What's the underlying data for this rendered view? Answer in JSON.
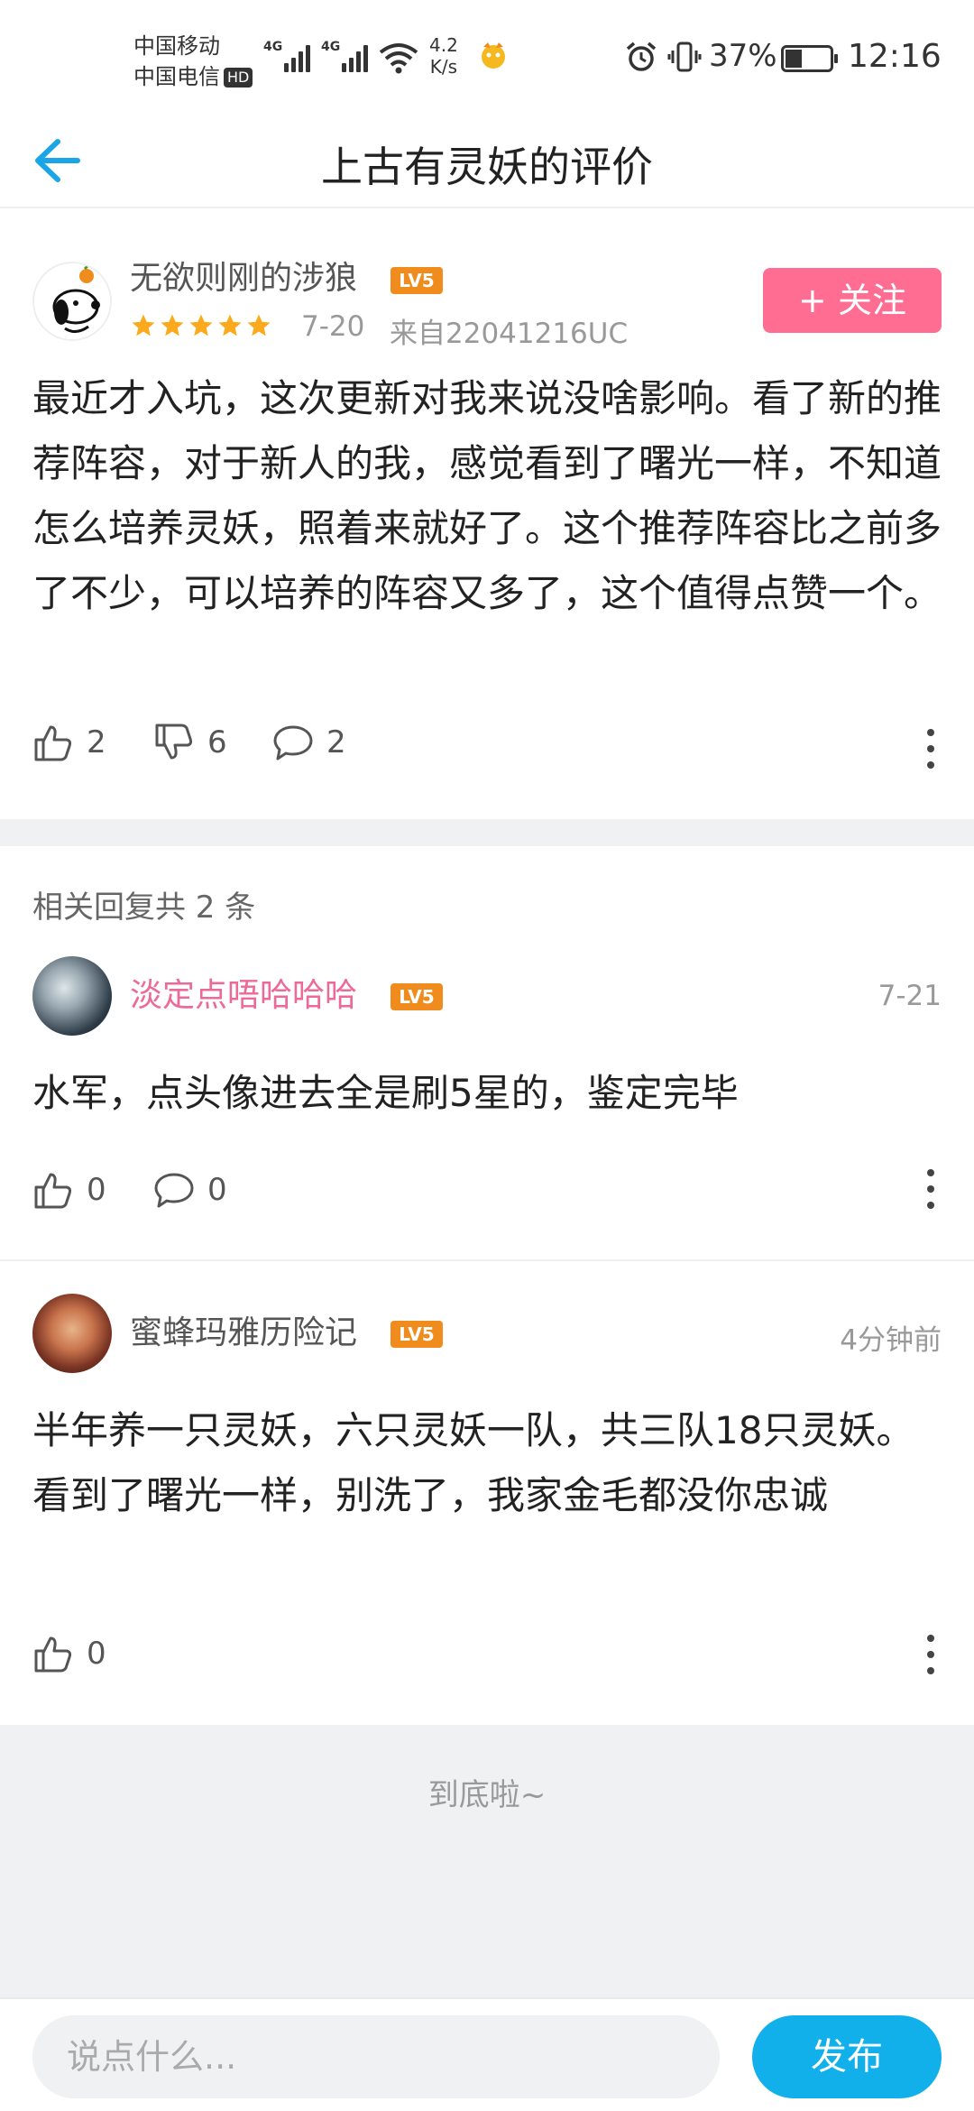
{
  "status_bar": {
    "carrier1": "中国移动",
    "carrier2": "中国电信",
    "hd": "HD",
    "net1": "4G",
    "net2": "4G",
    "speed_value": "4.2",
    "speed_unit": "K/s",
    "battery": "37%",
    "time": "12:16"
  },
  "header": {
    "title": "上古有灵妖的评价"
  },
  "review": {
    "username": "无欲则刚的涉狼",
    "level": "LV5",
    "rating_stars": 5,
    "date": "7-20",
    "device": "来自22041216UC",
    "follow_label": "+ 关注",
    "text": "最近才入坑，这次更新对我来说没啥影响。看了新的推荐阵容，对于新人的我，感觉看到了曙光一样，不知道怎么培养灵妖，照着来就好了。这个推荐阵容比之前多了不少，可以培养的阵容又多了，这个值得点赞一个。",
    "likes": "2",
    "dislikes": "6",
    "comments": "2"
  },
  "replies_header": "相关回复共 2 条",
  "replies": [
    {
      "username": "淡定点唔哈哈哈",
      "level": "LV5",
      "time": "7-21",
      "text": "水军，点头像进去全是刷5星的，鉴定完毕",
      "likes": "0",
      "comments": "0"
    },
    {
      "username": "蜜蜂玛雅历险记",
      "level": "LV5",
      "time": "4分钟前",
      "text": "半年养一只灵妖，六只灵妖一队，共三队18只灵妖。看到了曙光一样，别洗了，我家金毛都没你忠诚",
      "likes": "0"
    }
  ],
  "end_text": "到底啦~",
  "bottom_bar": {
    "input_placeholder": "说点什么...",
    "publish_label": "发布"
  },
  "colors": {
    "accent_blue": "#12b0ea",
    "follow_pink": "#ff6d93",
    "reply_name_pink": "#ec6a97",
    "level_orange": "#f08c1e",
    "star_orange": "#fbaa1e"
  }
}
